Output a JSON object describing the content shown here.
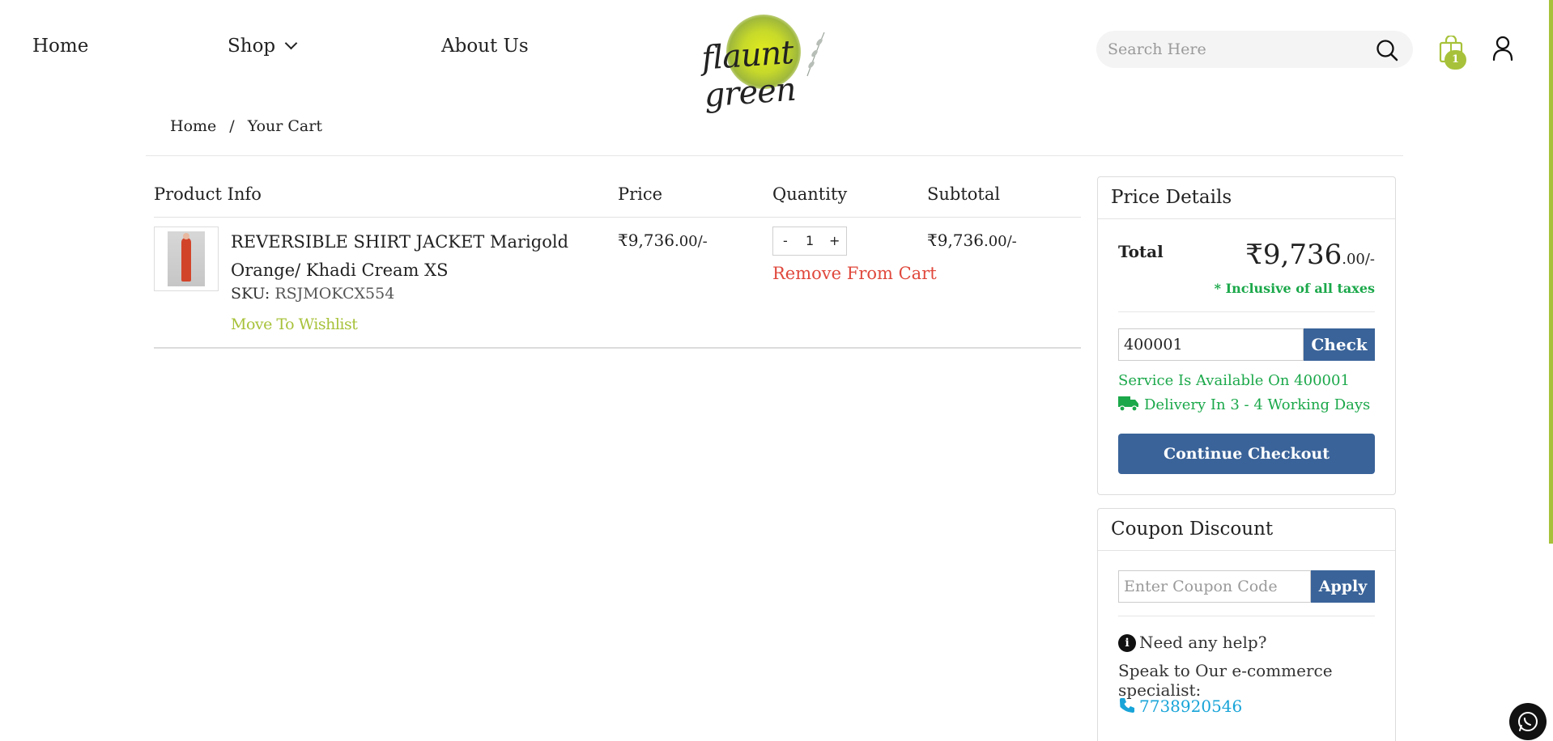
{
  "nav": {
    "home": "Home",
    "shop": "Shop",
    "about": "About Us"
  },
  "logo": {
    "text": "flaunt green"
  },
  "search": {
    "placeholder": "Search Here"
  },
  "cart": {
    "badge": "1"
  },
  "breadcrumb": {
    "home": "Home",
    "sep": "/",
    "current": "Your Cart"
  },
  "table": {
    "headers": {
      "product": "Product Info",
      "price": "Price",
      "quantity": "Quantity",
      "subtotal": "Subtotal"
    },
    "items": [
      {
        "name": "REVERSIBLE SHIRT JACKET Marigold Orange/ Khadi Cream XS",
        "sku_label": "SKU:",
        "sku": "RSJMOKCX554",
        "wishlist": "Move To Wishlist",
        "price_main": "₹9,736",
        "price_dec": ".00/-",
        "qty_minus": "-",
        "qty": "1",
        "qty_plus": "+",
        "remove": "Remove From Cart",
        "subtotal_main": "₹9,736",
        "subtotal_dec": ".00/-"
      }
    ]
  },
  "price_details": {
    "title": "Price Details",
    "total_label": "Total",
    "total_main": "₹9,736",
    "total_dec": ".00/-",
    "inclusive": "* Inclusive of all taxes",
    "pincode": "400001",
    "check": "Check",
    "service": "Service Is Available On 400001",
    "delivery": "Delivery In 3 - 4 Working Days",
    "checkout": "Continue Checkout"
  },
  "coupon": {
    "title": "Coupon Discount",
    "placeholder": "Enter Coupon Code",
    "apply": "Apply",
    "help": "Need any help?",
    "speak": "Speak to Our e-commerce specialist:",
    "phone": "7738920546"
  },
  "colors": {
    "accent_green": "#a7c23a",
    "success_green": "#1ba84a",
    "button_blue": "#3a6399",
    "remove_red": "#e0483c",
    "phone_cyan": "#18a4d8"
  }
}
